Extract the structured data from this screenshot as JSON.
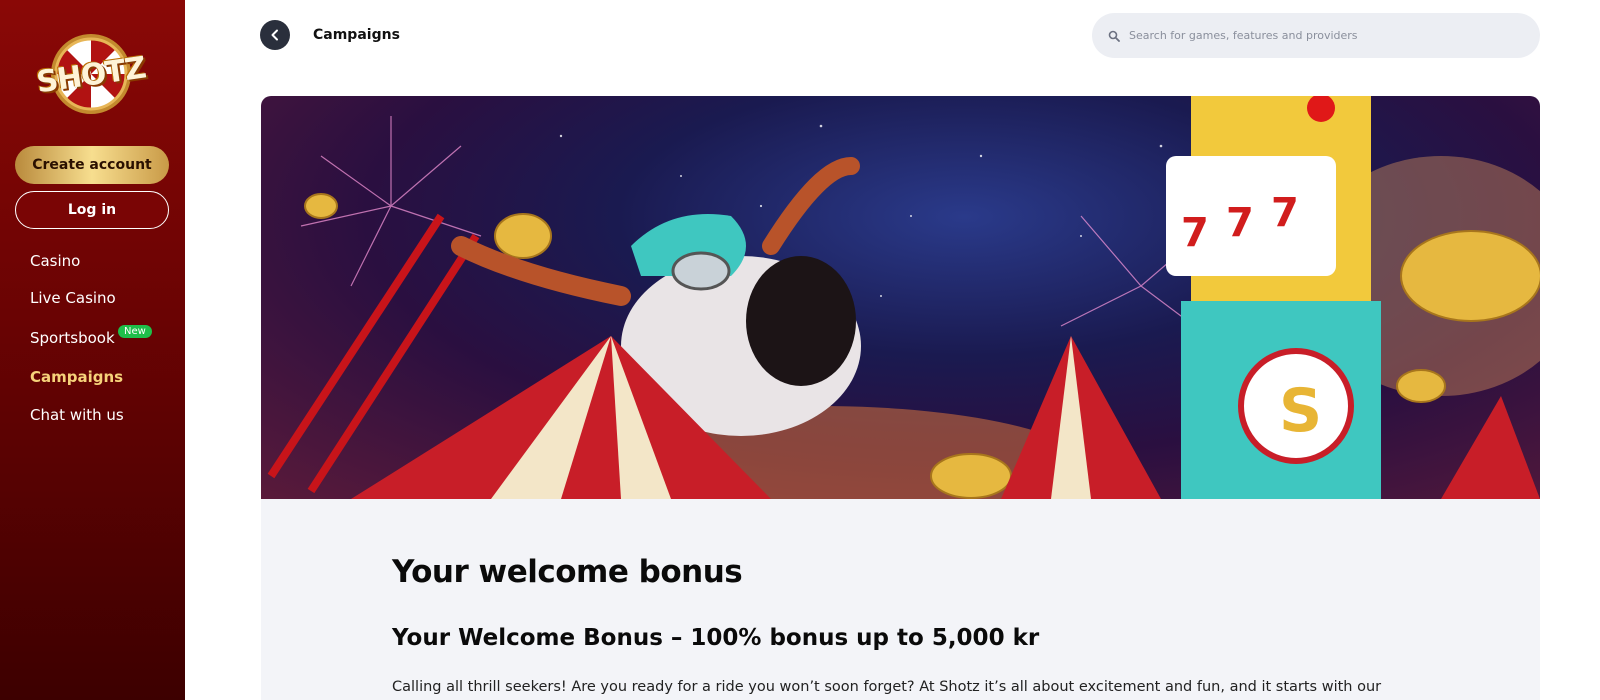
{
  "sidebar": {
    "logo_text": "SHOTZ",
    "create_account_label": "Create account",
    "login_label": "Log in",
    "nav": [
      {
        "label": "Casino"
      },
      {
        "label": "Live Casino"
      },
      {
        "label": "Sportsbook",
        "badge": "New"
      },
      {
        "label": "Campaigns",
        "active": true
      },
      {
        "label": "Chat with us"
      }
    ]
  },
  "header": {
    "title": "Campaigns",
    "search_placeholder": "Search for games, features and providers"
  },
  "content": {
    "heading": "Your welcome bonus",
    "subheading": "Your Welcome Bonus – 100% bonus up to 5,000 kr",
    "paragraph": "Calling all thrill seekers! Are you ready for a ride you won’t soon forget? At Shotz it’s all about excitement and fun, and it starts with our"
  },
  "colors": {
    "sidebar_top": "#8a0806",
    "sidebar_bottom": "#3d0000",
    "accent_gold": "#f6d27a",
    "badge_green": "#1fbf4a",
    "content_bg": "#f3f4f8"
  },
  "icons": {
    "back": "chevron-left-icon",
    "search": "search-icon"
  }
}
